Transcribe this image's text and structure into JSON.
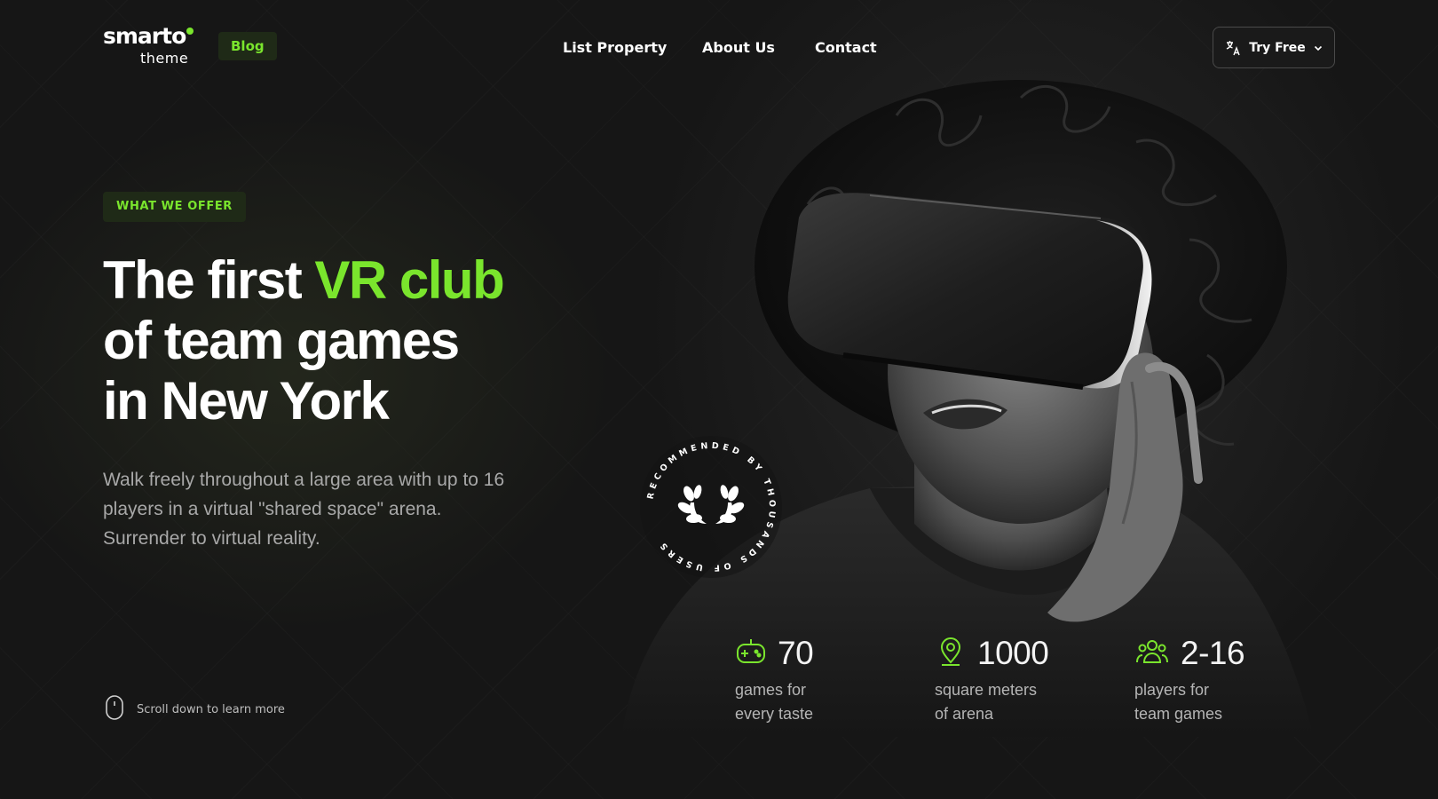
{
  "header": {
    "logo": {
      "main": "smarto",
      "sub": "theme"
    },
    "blog_label": "Blog",
    "nav": [
      "List Property",
      "About Us",
      "Contact"
    ],
    "try_free_label": "Try Free",
    "language_icon": "translate-icon",
    "dropdown_icon": "chevron-down-icon"
  },
  "hero": {
    "badge": "WHAT WE OFFER",
    "headline": {
      "part1": "The first ",
      "accent": "VR club",
      "line2": "of team games",
      "line3": "in New York"
    },
    "description": "Walk freely throughout a large area with up to 16 players in a virtual \"shared space\" arena. Surrender to virtual reality.",
    "scroll_hint": "Scroll down to learn more",
    "scroll_icon": "mouse-icon"
  },
  "badge_circle": {
    "text": "RECOMMENDED BY THOUSANDS OF USERS",
    "icon": "laurel-icon"
  },
  "stats": [
    {
      "icon": "gamepad-icon",
      "value": "70",
      "label": "games for\nevery taste"
    },
    {
      "icon": "location-pin-icon",
      "value": "1000",
      "label": "square meters\nof arena"
    },
    {
      "icon": "users-icon",
      "value": "2-16",
      "label": "players for\nteam games"
    }
  ],
  "colors": {
    "background": "#161616",
    "accent": "#7ae52d",
    "badge_bg": "#1f2a17",
    "text_muted": "#a8a8a8"
  }
}
